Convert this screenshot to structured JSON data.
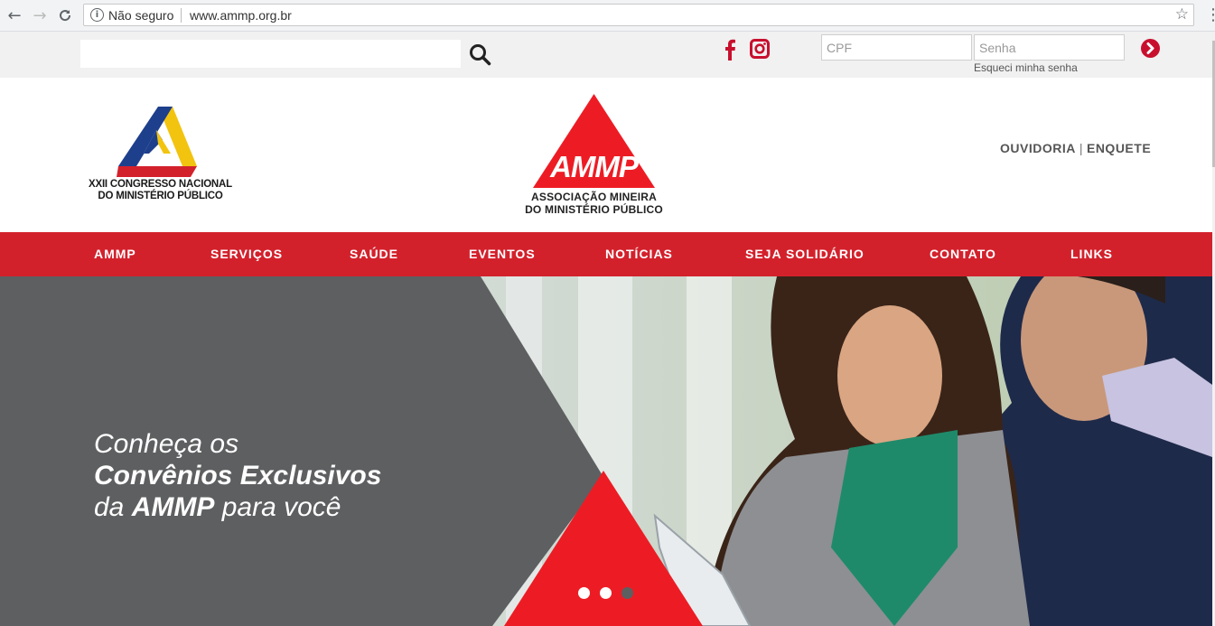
{
  "browser": {
    "security_label": "Não seguro",
    "url": "www.ammp.org.br",
    "icons": [
      "back-arrow-icon",
      "forward-arrow-icon",
      "reload-icon",
      "info-icon",
      "star-icon",
      "menu-dots-icon"
    ]
  },
  "topbar": {
    "search_placeholder": "",
    "cpf_placeholder": "CPF",
    "senha_placeholder": "Senha",
    "forgot_password": "Esqueci minha senha",
    "social_icons": [
      "facebook-icon",
      "instagram-icon"
    ],
    "accent_color": "#c8102e"
  },
  "header": {
    "congress_line1": "XXII CONGRESSO NACIONAL",
    "congress_line2": "DO MINISTÉRIO PÚBLICO",
    "logo_mark": "AMMP",
    "logo_line1": "ASSOCIAÇÃO MINEIRA",
    "logo_line2": "DO MINISTÉRIO PÚBLICO",
    "link_ouvidoria": "OUVIDORIA",
    "link_separator": "|",
    "link_enquete": "ENQUETE"
  },
  "nav": {
    "items": [
      "AMMP",
      "SERVIÇOS",
      "SAÚDE",
      "EVENTOS",
      "NOTÍCIAS",
      "SEJA SOLIDÁRIO",
      "CONTATO",
      "LINKS"
    ],
    "background": "#d3212c"
  },
  "hero": {
    "line1": "Conheça os",
    "line2": "Convênios Exclusivos",
    "line3_prefix": "da ",
    "line3_bold": "AMMP",
    "line3_suffix": " para você",
    "panel_color": "#5e5f61",
    "triangle_color": "#ed1c24",
    "slides_total": 3,
    "active_slide": 3
  }
}
